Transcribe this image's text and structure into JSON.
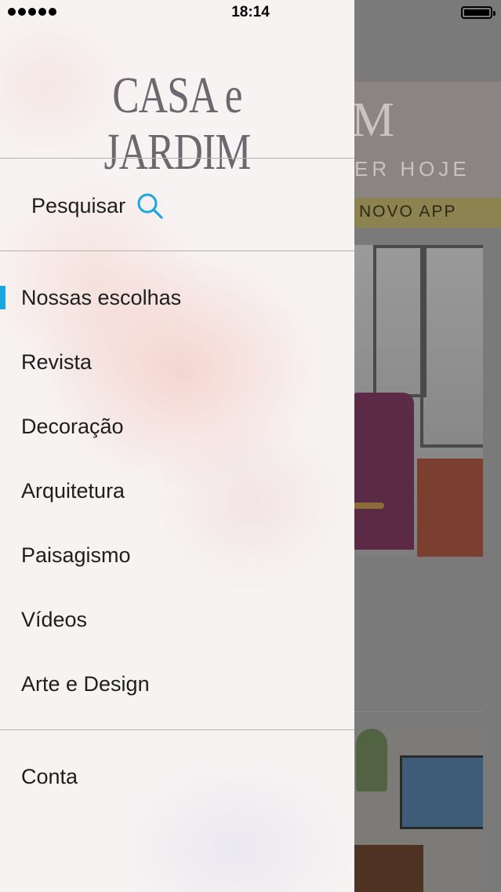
{
  "status_bar": {
    "time": "18:14"
  },
  "drawer": {
    "logo": "CASA e JARDIM",
    "search": {
      "label": "Pesquisar"
    },
    "menu": [
      {
        "label": "Nossas escolhas",
        "active": true
      },
      {
        "label": "Revista",
        "active": false
      },
      {
        "label": "Decoração",
        "active": false
      },
      {
        "label": "Arquitetura",
        "active": false
      },
      {
        "label": "Paisagismo",
        "active": false
      },
      {
        "label": "Vídeos",
        "active": false
      },
      {
        "label": "Arte e Design",
        "active": false
      }
    ],
    "account": {
      "label": "Conta"
    }
  },
  "background_app": {
    "logo_fragment": "M",
    "tagline_fragment": "ER HOJE",
    "banner_fragment": "NOVO APP"
  },
  "colors": {
    "accent": "#1aa7df",
    "logo": "#6d6770",
    "banner": "#8c8350"
  }
}
